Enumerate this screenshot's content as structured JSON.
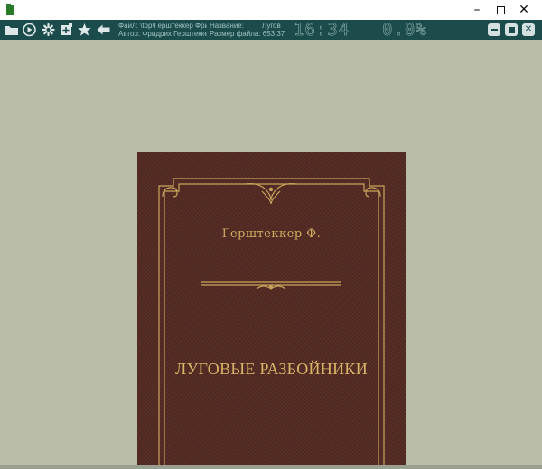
{
  "window": {
    "minimize_glyph": "–",
    "maximize_glyph": "",
    "close_glyph": "✕"
  },
  "toolbar": {
    "icons": [
      "folder-icon",
      "play-icon",
      "gear-icon",
      "add-bookmark-icon",
      "star-icon",
      "back-arrow-icon"
    ],
    "file_line": "Файл: \\top\\Герштеккер Фри",
    "author_line": "Автор: Фридрих Герштеккер",
    "name_line": "Название:         Лугов",
    "size_line": "Размер файла: 653.37",
    "time": "16:34",
    "progress": "0.0%",
    "accent": "#1b4b4b"
  },
  "cover": {
    "author": "Герштеккер Ф.",
    "title": "ЛУГОВЫЕ РАЗБОЙНИКИ",
    "background": "#522a22",
    "gold": "#d2ad62"
  },
  "background": "#b9bda7"
}
